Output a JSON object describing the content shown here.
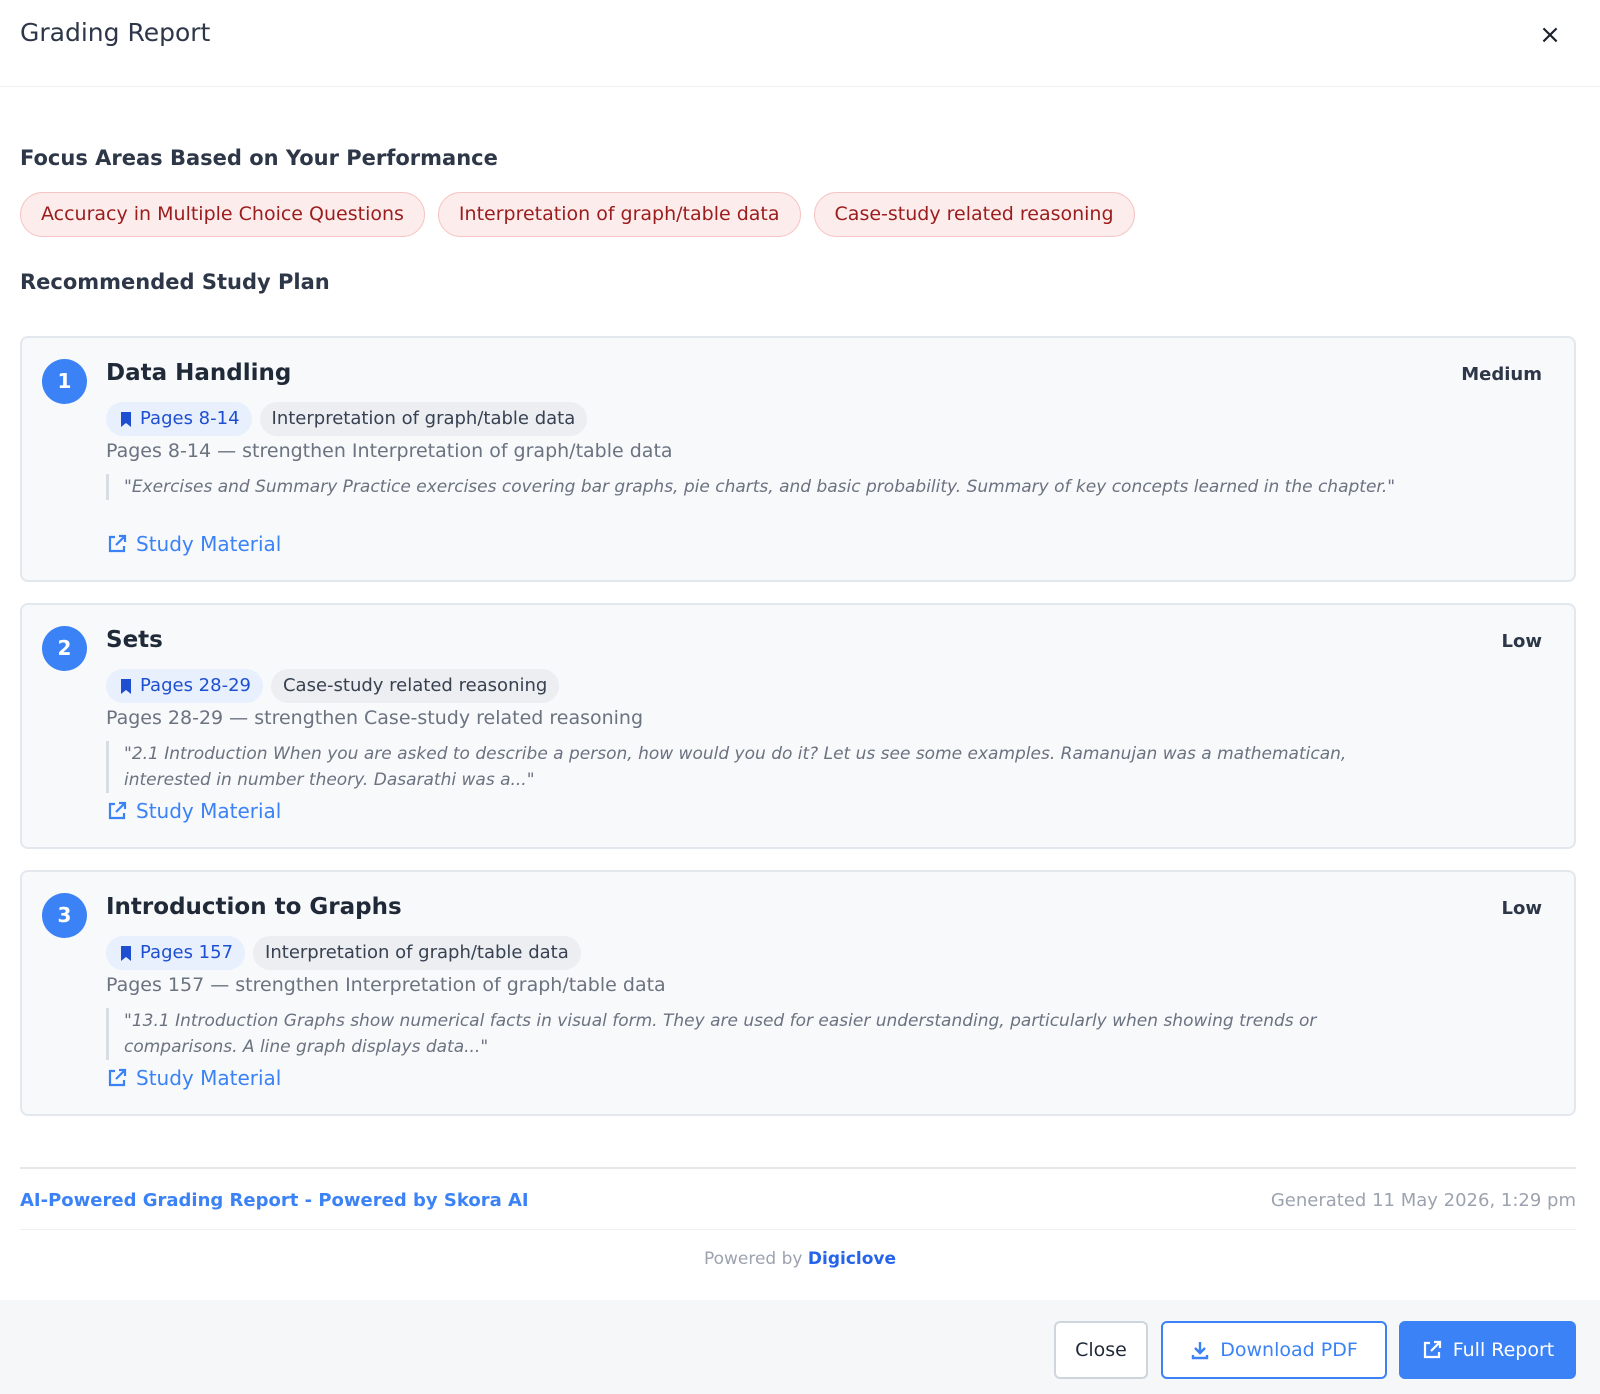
{
  "modal": {
    "title": "Grading Report",
    "close_symbol": "×"
  },
  "focus": {
    "heading": "Focus Areas Based on Your Performance",
    "areas": [
      "Accuracy in Multiple Choice Questions",
      "Interpretation of graph/table data",
      "Case-study related reasoning"
    ]
  },
  "plan": {
    "heading": "Recommended Study Plan",
    "items": [
      {
        "number": "1",
        "title": "Data Handling",
        "priority": "Medium",
        "pages": "Pages 8-14",
        "topic": "Interpretation of graph/table data",
        "summary": "Pages 8-14 — strengthen Interpretation of graph/table data",
        "excerpt": "\"Exercises and Summary Practice exercises covering bar graphs, pie charts, and basic probability. Summary of key concepts learned in the chapter.\"",
        "link_label": "Study Material"
      },
      {
        "number": "2",
        "title": "Sets",
        "priority": "Low",
        "pages": "Pages 28-29",
        "topic": "Case-study related reasoning",
        "summary": "Pages 28-29 — strengthen Case-study related reasoning",
        "excerpt": "\"2.1 Introduction When you are asked to describe a person, how would you do it? Let us see some examples. Ramanujan was a mathematican, interested in number theory. Dasarathi was a...\"",
        "link_label": "Study Material"
      },
      {
        "number": "3",
        "title": "Introduction to Graphs",
        "priority": "Low",
        "pages": "Pages 157",
        "topic": "Interpretation of graph/table data",
        "summary": "Pages 157 — strengthen Interpretation of graph/table data",
        "excerpt": "\"13.1 Introduction Graphs show numerical facts in visual form. They are used for easier understanding, particularly when showing trends or comparisons. A line graph displays data...\"",
        "link_label": "Study Material"
      }
    ]
  },
  "footer": {
    "brand": "AI-Powered Grading Report - Powered by Skora AI",
    "generated": "Generated 11 May 2026, 1:29 pm",
    "powered_prefix": "Powered by",
    "powered_brand": "Digiclove"
  },
  "actions": {
    "close": "Close",
    "download": "Download PDF",
    "full_report": "Full Report"
  },
  "icons": {
    "close": "close-icon",
    "bookmark": "bookmark-icon",
    "external_link": "external-link-icon",
    "download": "download-icon"
  },
  "colors": {
    "accent": "#3b82f6",
    "focus_pill_bg": "#fdecec",
    "focus_pill_text": "#9b1c1c",
    "page_tag_bg": "#e8f0fd",
    "page_tag_text": "#1e4fd0"
  }
}
